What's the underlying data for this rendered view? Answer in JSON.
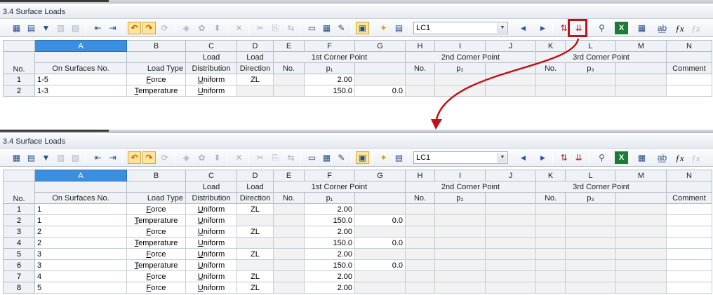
{
  "window": {
    "title": "3.4 Surface Loads"
  },
  "toolbar": {
    "load_case": "LC1"
  },
  "icons": [
    "table-view-icon",
    "insert-row-icon",
    "filter-icon",
    "chart-icon",
    "delete-row-icon",
    "move-left-icon",
    "move-right-icon",
    "undo-icon",
    "redo-icon",
    "refresh-icon",
    "select-icon",
    "settings-icon",
    "info-icon",
    "clear-icon",
    "cut-icon",
    "copy-icon",
    "paste-icon",
    "columns-icon",
    "table-icon",
    "edit-icon",
    "view-icon",
    "generate-icon",
    "open-icon",
    "previous-icon",
    "next-icon",
    "split-icon",
    "expand-rows-icon",
    "link-icon",
    "excel-icon",
    "calculator-icon",
    "find-replace-icon",
    "function-icon",
    "function-off-icon"
  ],
  "columns": {
    "letters": [
      "A",
      "B",
      "C",
      "D",
      "E",
      "F",
      "G",
      "H",
      "I",
      "J",
      "K",
      "L",
      "M",
      "N"
    ],
    "no": "No.",
    "surfaces": "On Surfaces No.",
    "load_type": "Load Type",
    "load_dist_1": "Load",
    "load_dist_2": "Distribution",
    "load_dir_1": "Load",
    "load_dir_2": "Direction",
    "corner1": "1st Corner Point",
    "corner2": "2nd Corner Point",
    "corner3": "3rd Corner Point",
    "sub_no": "No.",
    "p1": "p₁",
    "p2": "p₂",
    "p3": "p₃",
    "comment": "Comment"
  },
  "table_before": [
    {
      "no": "1",
      "surfaces": "1-5",
      "type": "Force",
      "dist": "Uniform",
      "dir": "ZL",
      "p": "2.00",
      "g": ""
    },
    {
      "no": "2",
      "surfaces": "1-3",
      "type": "Temperature",
      "dist": "Uniform",
      "dir": "",
      "p": "150.0",
      "g": "0.0"
    }
  ],
  "table_after": [
    {
      "no": "1",
      "surfaces": "1",
      "type": "Force",
      "dist": "Uniform",
      "dir": "ZL",
      "p": "2.00",
      "g": ""
    },
    {
      "no": "2",
      "surfaces": "1",
      "type": "Temperature",
      "dist": "Uniform",
      "dir": "",
      "p": "150.0",
      "g": "0.0"
    },
    {
      "no": "3",
      "surfaces": "2",
      "type": "Force",
      "dist": "Uniform",
      "dir": "ZL",
      "p": "2.00",
      "g": ""
    },
    {
      "no": "4",
      "surfaces": "2",
      "type": "Temperature",
      "dist": "Uniform",
      "dir": "",
      "p": "150.0",
      "g": "0.0"
    },
    {
      "no": "5",
      "surfaces": "3",
      "type": "Force",
      "dist": "Uniform",
      "dir": "ZL",
      "p": "2.00",
      "g": ""
    },
    {
      "no": "6",
      "surfaces": "3",
      "type": "Temperature",
      "dist": "Uniform",
      "dir": "",
      "p": "150.0",
      "g": "0.0"
    },
    {
      "no": "7",
      "surfaces": "4",
      "type": "Force",
      "dist": "Uniform",
      "dir": "ZL",
      "p": "2.00",
      "g": ""
    },
    {
      "no": "8",
      "surfaces": "5",
      "type": "Force",
      "dist": "Uniform",
      "dir": "ZL",
      "p": "2.00",
      "g": ""
    }
  ],
  "colors": {
    "selected_column": "#3b8fe0",
    "annotation": "#c0121b",
    "active_button": "#fde59a"
  }
}
